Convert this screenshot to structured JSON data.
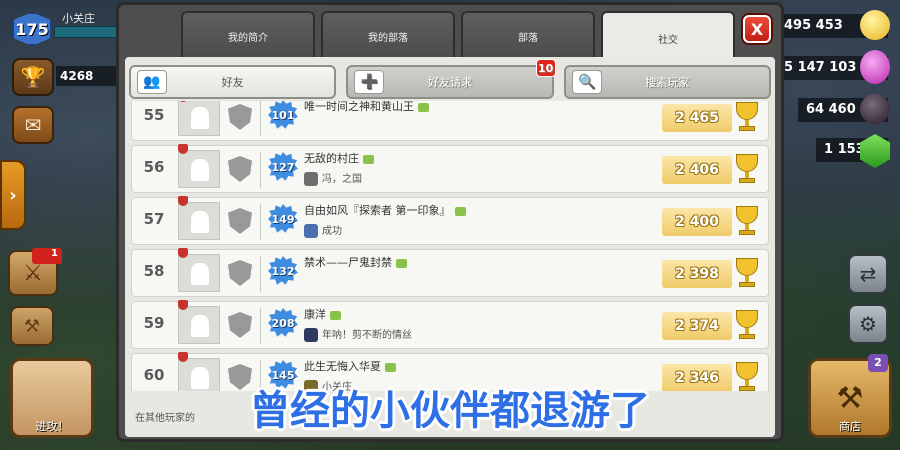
{
  "player": {
    "level": "175",
    "name": "小关庄",
    "trophies": "4268"
  },
  "resources": {
    "gold": "495 453",
    "elixir": "5 147 103",
    "dark_elixir": "64 460",
    "gems": "1 153"
  },
  "war_badge": "1",
  "attack_label": "进攻！",
  "shop_label": "商店",
  "shop_badge": "2",
  "tabs": [
    {
      "label": "我的简介"
    },
    {
      "label": "我的部落"
    },
    {
      "label": "部落"
    },
    {
      "label": "社交"
    }
  ],
  "close_label": "X",
  "subtabs": [
    {
      "label": "好友"
    },
    {
      "label": "好友请求",
      "badge": "10"
    },
    {
      "label": "搜索玩家"
    }
  ],
  "friends": [
    {
      "rank": "55",
      "level": "101",
      "name": "唯一时间之神和黄山王",
      "clan": "",
      "trophies": "2 465"
    },
    {
      "rank": "56",
      "level": "127",
      "name": "无敌的村庄",
      "clan": "冯，之国",
      "trophies": "2 406"
    },
    {
      "rank": "57",
      "level": "149",
      "name": "自由如风『探索者 第一印象』",
      "clan": "成功",
      "trophies": "2 400"
    },
    {
      "rank": "58",
      "level": "132",
      "name": "禁术——尸鬼封禁",
      "clan": "",
      "trophies": "2 398"
    },
    {
      "rank": "59",
      "level": "208",
      "name": "康洋",
      "clan": "年呐！剪不断的情丝",
      "trophies": "2 374"
    },
    {
      "rank": "60",
      "level": "145",
      "name": "此生无悔入华夏",
      "clan": "小关庄",
      "trophies": "2 346"
    }
  ],
  "footer_text": "在其他玩家的",
  "caption": "曾经的小伙伴都退游了"
}
